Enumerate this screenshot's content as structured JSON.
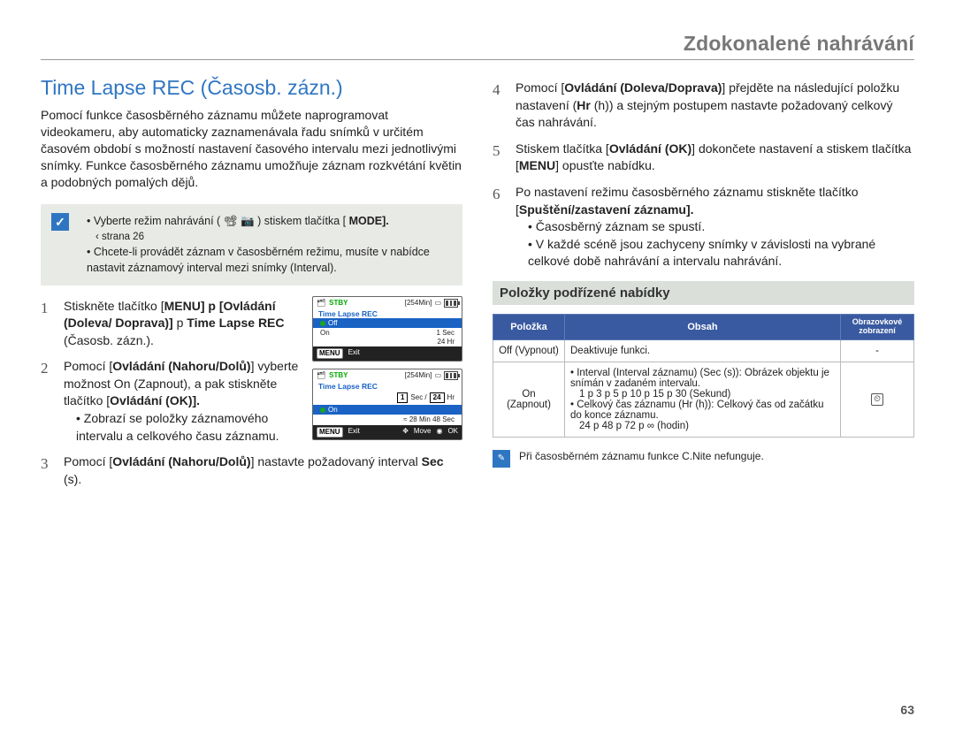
{
  "header": {
    "section_title": "Zdokonalené nahrávání"
  },
  "heading": "Time Lapse REC (Časosb. zázn.)",
  "intro": "Pomocí funkce časosběrného záznamu můžete naprogramovat videokameru, aby automaticky zaznamenávala řadu snímků v určitém časovém období s možností nastavení časového intervalu mezi jednotlivými snímky. Funkce časosběrného záznamu umožňuje záznam rozkvétání květin a podobných pomalých dějů.",
  "tip": {
    "line1_a": "• Vyberte režim nahrávání (",
    "line1_b": ") stiskem tlačítka [",
    "line1_c": "MODE].",
    "pageref": "‹ strana 26",
    "line2": "• Chcete-li provádět záznam v časosběrném režimu, musíte v nabídce nastavit záznamový interval mezi snímky (Interval)."
  },
  "steps_left": {
    "s1_a": "Stiskněte tlačítko [",
    "s1_b": "MENU] p",
    "s1_c": "[Ovládání (Doleva/ Doprava)]",
    "s1_d": " p ",
    "s1_e": "Time Lapse REC",
    "s1_f": " (Časosb. zázn.).",
    "s2_a": "Pomocí [",
    "s2_b": "Ovládání (Nahoru/Dolů)",
    "s2_c": "] vyberte možnost On (Zapnout), a pak stiskněte tlačítko [",
    "s2_d": "Ovládání (OK)].",
    "s2_bullet": "• Zobrazí se položky záznamového intervalu a celkového času záznamu.",
    "s3_a": "Pomocí [",
    "s3_b": "Ovládání (Nahoru/Dolů)",
    "s3_c": "] nastavte požadovaný interval ",
    "s3_d": "Sec",
    "s3_e": " (s)."
  },
  "steps_right": {
    "s4_a": "Pomocí [",
    "s4_b": "Ovládání (Doleva/Doprava)",
    "s4_c": "] přejděte na následující položku nastavení (",
    "s4_d": "Hr",
    "s4_e": " (h)) a stejným postupem nastavte požadovaný celkový čas nahrávání.",
    "s5_a": "Stiskem tlačítka [",
    "s5_b": "Ovládání (OK)",
    "s5_c": "] dokončete nastavení a stiskem tlačítka [",
    "s5_d": "MENU",
    "s5_e": "] opusťte nabídku.",
    "s6_a": "Po nastavení režimu časosběrného záznamu stiskněte tlačítko [",
    "s6_b": "Spuštění/zastavení záznamu].",
    "s6_b1": "• Časosběrný záznam se spustí.",
    "s6_b2": "• V každé scéně jsou zachyceny snímky v závislosti na vybrané celkové době nahrávání a intervalu nahrávání."
  },
  "submenu": {
    "title": "Položky podřízené nabídky",
    "th1": "Položka",
    "th2": "Obsah",
    "th3a": "Obrazovkové",
    "th3b": "zobrazení",
    "off_label": "Off (Vypnout)",
    "off_desc": "Deaktivuje funkci.",
    "off_disp": "-",
    "on_label": "On (Zapnout)",
    "on_l1": "• Interval (Interval záznamu) (Sec (s)): Obrázek objektu je snímán v zadaném intervalu.",
    "on_l2": "1 p 3 p 5 p 10 p 15 p 30 (Sekund)",
    "on_l3": "• Celkový čas záznamu (Hr (h)): Celkový čas od začátku do konce záznamu.",
    "on_l4": "24 p 48 p 72 p ∞ (hodin)"
  },
  "lcd1": {
    "stby": "STBY",
    "mins": "[254Min]",
    "title": "Time Lapse REC",
    "off": "Off",
    "on": "On",
    "r1": "1 Sec",
    "r2": "24 Hr",
    "menu": "MENU",
    "exit": "Exit"
  },
  "lcd2": {
    "stby": "STBY",
    "mins": "[254Min]",
    "title": "Time Lapse REC",
    "on": "On",
    "sec": "1",
    "seclab": "Sec /",
    "hr": "24",
    "hrlab": "Hr",
    "est": "≈ 28 Min 48 Sec",
    "menu": "MENU",
    "exit": "Exit",
    "move": "Move",
    "ok": "OK"
  },
  "note": "Při časosběrném záznamu funkce C.Nite nefunguje.",
  "pagenum": "63"
}
